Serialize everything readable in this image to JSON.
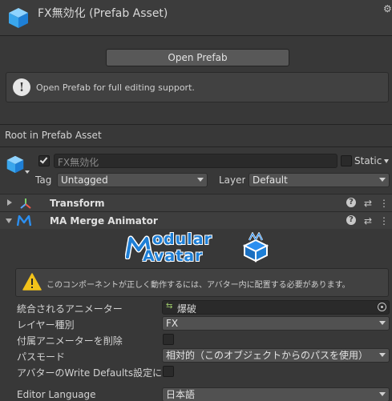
{
  "header": {
    "title": "FX無効化 (Prefab Asset)"
  },
  "prefab": {
    "open_button": "Open Prefab",
    "help_text": "Open Prefab for full editing support."
  },
  "root_label": "Root in Prefab Asset",
  "gameobject": {
    "name": "FX無効化",
    "static_label": "Static",
    "tag_label": "Tag",
    "tag_value": "Untagged",
    "layer_label": "Layer",
    "layer_value": "Default"
  },
  "components": {
    "transform": {
      "label": "Transform"
    },
    "merge_animator": {
      "label": "MA Merge Animator"
    }
  },
  "logo": {
    "line1": "odular",
    "line2": "vatar"
  },
  "warning": {
    "text": "このコンポーネントが正しく動作するには、アバター内に配置する必要があります。"
  },
  "fields": {
    "animator_label": "統合されるアニメーター",
    "animator_value": "爆破",
    "layer_type_label": "レイヤー種別",
    "layer_type_value": "FX",
    "delete_attached_label": "付属アニメーターを削除",
    "path_mode_label": "パスモード",
    "path_mode_value": "相対的（このオブジェクトからのパスを使用）",
    "write_defaults_label": "アバターのWrite Defaults設定に合わ",
    "editor_language_label": "Editor Language",
    "editor_language_value": "日本語"
  },
  "colors": {
    "background": "#383838",
    "logo_blue": "#1e7fd6",
    "warning_yellow": "#f2c21a"
  }
}
